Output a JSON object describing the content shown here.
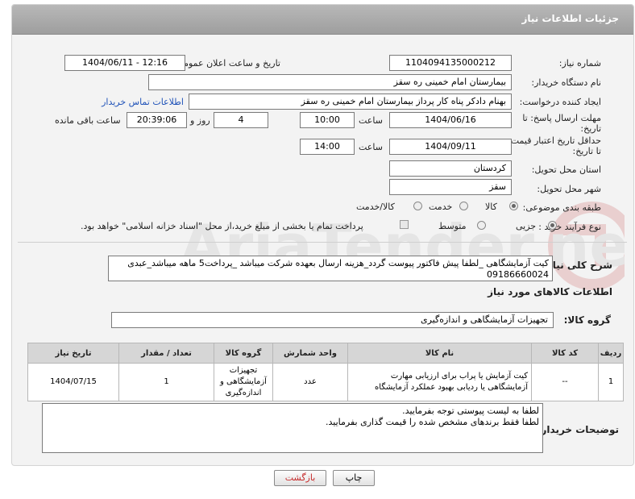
{
  "header": {
    "title": "جزئیات اطلاعات نیاز"
  },
  "fields": {
    "need_number_label": "شماره نیاز:",
    "need_number": "1104094135000212",
    "announce_label": "تاریخ و ساعت اعلان عمومی:",
    "announce_value": "1404/06/11 - 12:16",
    "buyer_org_label": "نام دستگاه خریدار:",
    "buyer_org": "بیمارستان امام خمینی  ره  سقز",
    "requester_label": "ایجاد کننده درخواست:",
    "requester": "بهنام دادکر پناه کار پرداز بیمارستان امام خمینی  ره  سقز",
    "contact_link": "اطلاعات تماس خریدار",
    "reply_deadline_label": "مهلت ارسال پاسخ: تا",
    "reply_deadline_label2": "تاریخ:",
    "reply_date": "1404/06/16",
    "time_label": "ساعت",
    "reply_time": "10:00",
    "days_value": "4",
    "days_label": "روز و",
    "remaining_time": "20:39:06",
    "remaining_label": "ساعت باقی مانده",
    "price_validity_label": "حداقل تاریخ اعتبار قیمت:",
    "price_validity_label2": "تا تاریخ:",
    "validity_date": "1404/09/11",
    "validity_time_label": "ساعت",
    "validity_time": "14:00",
    "province_label": "استان محل تحویل:",
    "province": "کردستان",
    "city_label": "شهر محل تحویل:",
    "city": "سقز",
    "category_label": "طبقه بندی موضوعی:",
    "category_options": [
      "کالا",
      "خدمت",
      "کالا/خدمت"
    ],
    "process_label": "نوع فرآیند خرید :",
    "process_options": [
      "جزیی",
      "متوسط"
    ],
    "payment_note": "پرداخت تمام یا بخشی از مبلغ خرید،از محل \"اسناد خزانه اسلامی\" خواهد بود.",
    "description_label": "شرح کلی نیاز:",
    "description": "کیت آزمایشگاهی _لطفا پیش فاکتور پیوست گردد_هزینه ارسال بعهده شرکت میباشد _پرداخت5 ماهه میباشد_عبدی 09186660024",
    "goods_info_title": "اطلاعات کالاهای مورد نیاز",
    "goods_group_label": "گروه کالا:",
    "goods_group": "تجهیزات آزمایشگاهی و اندازه‌گیری",
    "buyer_notes_label": "توضیحات خریدار:",
    "buyer_notes": "لطفا به لیست پیوستی توجه بفرمایید.\nلطفا فقط برندهای مشخص شده را قیمت گذاری بفرمایید."
  },
  "table": {
    "headers": [
      "ردیف",
      "کد کالا",
      "نام کالا",
      "واحد شمارش",
      "گروه کالا",
      "تعداد / مقدار",
      "تاریخ نیاز"
    ],
    "rows": [
      [
        "1",
        "--",
        "کیت آزمایش یا پراب برای ارزیابی مهارت آزمایشگاهی یا ردیابی بهبود عملکرد آزمایشگاه",
        "عدد",
        "تجهیزات آزمایشگاهی و اندازه‌گیری",
        "1",
        "1404/07/15"
      ]
    ]
  },
  "buttons": {
    "print": "چاپ",
    "back": "بازگشت"
  },
  "watermark": {
    "text": "AriaTender.neT"
  },
  "colors": {
    "header": "#a8a8a8",
    "link": "#1f52b8",
    "back_button_text": "#c62828",
    "watermark": "#b71c1c"
  }
}
